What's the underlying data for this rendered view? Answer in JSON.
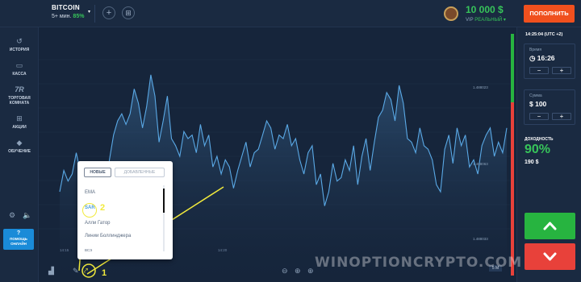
{
  "asset": {
    "name": "BITCOIN",
    "duration": "5+ мин.",
    "payout": "85%",
    "caret": "▾"
  },
  "toolbar": {
    "add": "+",
    "grid": "⊞"
  },
  "account": {
    "balance": "10 000 $",
    "label": "VIP",
    "type": "РЕАЛЬНЫЙ ▾"
  },
  "deposit_label": "ПОПОЛНИТЬ",
  "sidebar": {
    "items": [
      {
        "icon": "↺",
        "label": "ИСТОРИЯ"
      },
      {
        "icon": "▭",
        "label": "КАССА"
      },
      {
        "icon": "7R",
        "label": "ТОРГОВАЯ КОМНАТА"
      },
      {
        "icon": "⊞",
        "label": "АКЦИИ"
      },
      {
        "icon": "◆",
        "label": "ОБУЧЕНИЕ"
      }
    ],
    "settings_icon": "⚙",
    "sound_icon": "🔈",
    "help_q": "?",
    "help_label": "ПОМОЩЬ ОНЛАЙН"
  },
  "chart_data": {
    "type": "area",
    "y": [
      30,
      42,
      36,
      40,
      52,
      41,
      28,
      18,
      24,
      45,
      38,
      30,
      48,
      62,
      70,
      74,
      68,
      74,
      88,
      80,
      66,
      78,
      96,
      84,
      58,
      70,
      84,
      60,
      56,
      50,
      64,
      60,
      62,
      52,
      68,
      56,
      62,
      44,
      50,
      40,
      48,
      44,
      32,
      42,
      50,
      58,
      44,
      52,
      54,
      62,
      70,
      66,
      54,
      62,
      60,
      68,
      56,
      60,
      48,
      40,
      52,
      56,
      34,
      40,
      22,
      30,
      46,
      36,
      38,
      48,
      42,
      56,
      34,
      50,
      60,
      42,
      58,
      72,
      76,
      86,
      82,
      70,
      90,
      80,
      60,
      58,
      52,
      66,
      56,
      54,
      48,
      34,
      30,
      54,
      62,
      46,
      66,
      56,
      62,
      44,
      48,
      40,
      56,
      62,
      66,
      50,
      58,
      52,
      66
    ],
    "price_labels": [
      "1.488023",
      "1.488063",
      "1.488033"
    ],
    "time_labels": [
      "14:15",
      "14:20"
    ],
    "grid": true,
    "line_color": "#5aa9e6"
  },
  "chart_tools": {
    "candles": "▟",
    "pencil": "✎",
    "indicator": "⤤",
    "zoom_out": "⊖",
    "target": "⊕",
    "zoom_in": "⊕",
    "timeframe": "5 M"
  },
  "popup": {
    "tabs": {
      "new": "НОВЫЕ",
      "added": "ДОБАВЛЕННЫЕ"
    },
    "indicators": [
      "EMA",
      "SAR",
      "Алли Гатор",
      "Линии Боллинджера",
      "ВСЭ"
    ]
  },
  "annotations": {
    "one": "1",
    "two": "2"
  },
  "panel": {
    "time": "14:25:04 (UTC +2)",
    "duration_label": "Время",
    "duration_value": "16:26",
    "amount_label": "Сумма",
    "amount_value": "$ 100",
    "minus": "−",
    "plus": "+",
    "profit_label": "ДОХОДНОСТЬ",
    "profit_pct": "90%",
    "profit_amount": "190 $"
  },
  "watermark": "WINOPTIONCRYPTO.COM",
  "colors": {
    "up": "#27b440",
    "down": "#e8413a",
    "accent": "#f0501e",
    "annotation": "#f1ea3c"
  }
}
